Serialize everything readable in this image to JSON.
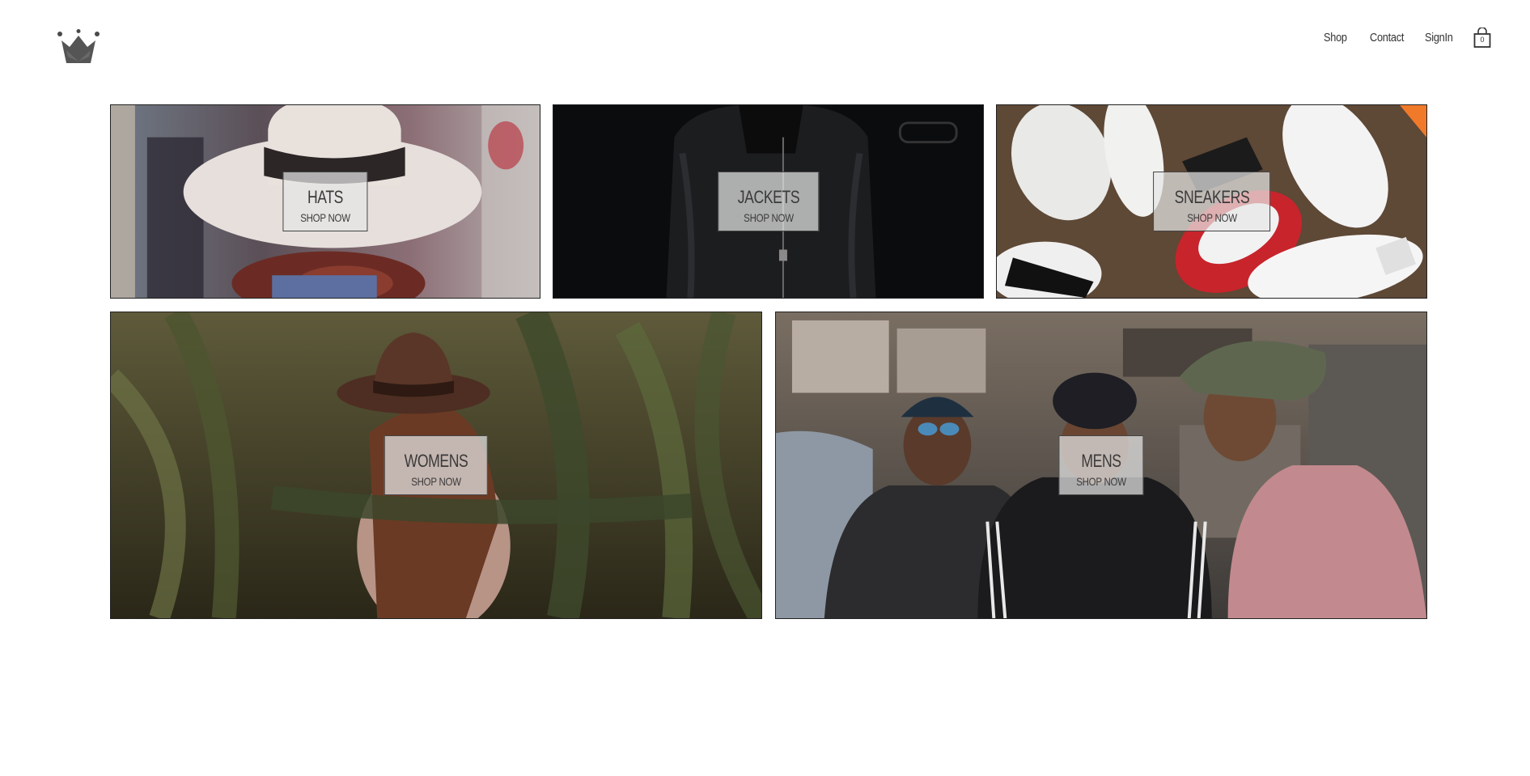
{
  "brand": {
    "logo_icon": "crown-icon",
    "logo_color": "#4a4a4a"
  },
  "nav": {
    "shop": "Shop",
    "contact": "Contact",
    "signin": "SignIn",
    "cart_icon": "shopping-bag-icon",
    "cart_count": "0"
  },
  "categories": [
    {
      "title": "HATS",
      "cta": "SHOP NOW"
    },
    {
      "title": "JACKETS",
      "cta": "SHOP NOW"
    },
    {
      "title": "SNEAKERS",
      "cta": "SHOP NOW"
    },
    {
      "title": "WOMENS",
      "cta": "SHOP NOW"
    },
    {
      "title": "MENS",
      "cta": "SHOP NOW"
    }
  ]
}
